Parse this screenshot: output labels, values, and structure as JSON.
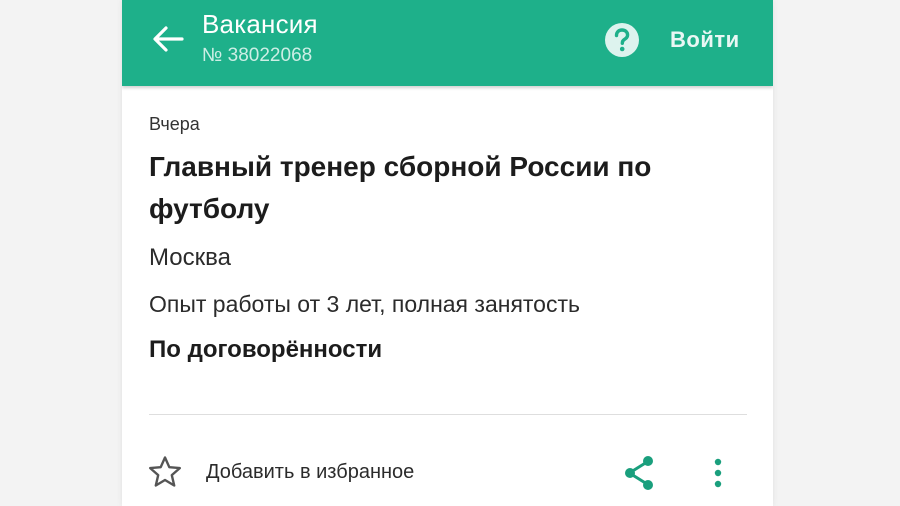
{
  "colors": {
    "accent": "#1eb08a",
    "icon_green": "#1a9f7d",
    "text_dark": "#1c1c1c"
  },
  "appbar": {
    "back_icon": "arrow-left-icon",
    "title": "Вакансия",
    "subtitle": "№ 38022068",
    "help_icon": "question-circle-icon",
    "login_label": "Войти"
  },
  "vacancy": {
    "date": "Вчера",
    "title": "Главный тренер сборной России по футболу",
    "city": "Москва",
    "experience": "Опыт работы от 3 лет, полная занятость",
    "salary": "По договорённости"
  },
  "actions": {
    "favorite_icon": "star-outline-icon",
    "favorite_label": "Добавить в избранное",
    "share_icon": "share-icon",
    "more_icon": "more-vertical-icon"
  }
}
